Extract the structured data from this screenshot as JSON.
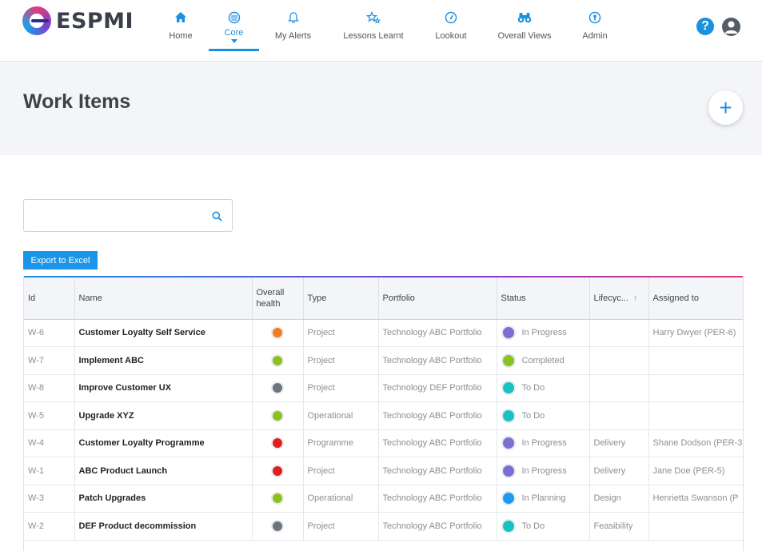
{
  "app": {
    "logo_text": "ESPMI"
  },
  "nav": {
    "items": [
      {
        "label": "Home",
        "icon": "home-icon"
      },
      {
        "label": "Core",
        "icon": "core-icon"
      },
      {
        "label": "My Alerts",
        "icon": "bell-icon"
      },
      {
        "label": "Lessons Learnt",
        "icon": "stars-icon"
      },
      {
        "label": "Lookout",
        "icon": "gauge-icon"
      },
      {
        "label": "Overall Views",
        "icon": "binoculars-icon"
      },
      {
        "label": "Admin",
        "icon": "key-icon"
      }
    ],
    "active": "Core"
  },
  "header": {
    "help": "?",
    "title": "Work Items",
    "add": "+"
  },
  "search": {
    "placeholder": "",
    "value": ""
  },
  "toolbar": {
    "export_label": "Export to Excel"
  },
  "colors": {
    "accent": "#1b8fe0",
    "orange": "#f57c20",
    "green": "#8cc21d",
    "grey": "#6c757d",
    "red": "#e31e1e",
    "purple": "#7b6fd6",
    "teal": "#17c2c2",
    "blue": "#1b9cf0"
  },
  "table": {
    "columns": {
      "id": "Id",
      "name": "Name",
      "health_line1": "Overall",
      "health_line2": "health",
      "type": "Type",
      "portfolio": "Portfolio",
      "status": "Status",
      "lifecycle": "Lifecyc...",
      "assigned": "Assigned to"
    },
    "rows": [
      {
        "id": "W-6",
        "name": "Customer Loyalty Self Service",
        "health": "#f57c20",
        "type": "Project",
        "portfolio": "Technology ABC Portfolio",
        "status": "In Progress",
        "status_color": "#7b6fd6",
        "lifecycle": "",
        "assigned": "Harry Dwyer (PER-6)"
      },
      {
        "id": "W-7",
        "name": "Implement ABC",
        "health": "#8cc21d",
        "type": "Project",
        "portfolio": "Technology ABC Portfolio",
        "status": "Completed",
        "status_color": "#8cc21d",
        "lifecycle": "",
        "assigned": ""
      },
      {
        "id": "W-8",
        "name": "Improve Customer UX",
        "health": "#6c757d",
        "type": "Project",
        "portfolio": "Technology DEF Portfolio",
        "status": "To Do",
        "status_color": "#17c2c2",
        "lifecycle": "",
        "assigned": ""
      },
      {
        "id": "W-5",
        "name": "Upgrade XYZ",
        "health": "#8cc21d",
        "type": "Operational",
        "portfolio": "Technology ABC Portfolio",
        "status": "To Do",
        "status_color": "#17c2c2",
        "lifecycle": "",
        "assigned": ""
      },
      {
        "id": "W-4",
        "name": "Customer Loyalty Programme",
        "health": "#e31e1e",
        "type": "Programme",
        "portfolio": "Technology ABC Portfolio",
        "status": "In Progress",
        "status_color": "#7b6fd6",
        "lifecycle": "Delivery",
        "assigned": "Shane Dodson (PER-3"
      },
      {
        "id": "W-1",
        "name": "ABC Product Launch",
        "health": "#e31e1e",
        "type": "Project",
        "portfolio": "Technology ABC Portfolio",
        "status": "In Progress",
        "status_color": "#7b6fd6",
        "lifecycle": "Delivery",
        "assigned": "Jane Doe (PER-5)"
      },
      {
        "id": "W-3",
        "name": "Patch Upgrades",
        "health": "#8cc21d",
        "type": "Operational",
        "portfolio": "Technology ABC Portfolio",
        "status": "In Planning",
        "status_color": "#1b9cf0",
        "lifecycle": "Design",
        "assigned": "Henrietta Swanson (P"
      },
      {
        "id": "W-2",
        "name": "DEF Product decommission",
        "health": "#6c757d",
        "type": "Project",
        "portfolio": "Technology ABC Portfolio",
        "status": "To Do",
        "status_color": "#17c2c2",
        "lifecycle": "Feasibility",
        "assigned": ""
      }
    ]
  }
}
